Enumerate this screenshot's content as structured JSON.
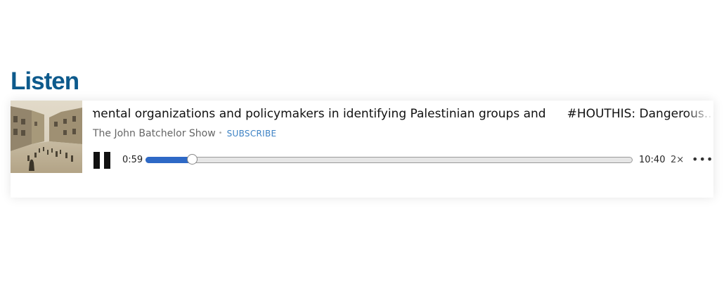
{
  "heading": "Listen",
  "player": {
    "episode_titles": [
      "ımental organizations and policymakers in identifying Palestinian groups and",
      "#HOUTHIS: Dangerous..."
    ],
    "show_name": "The John Batchelor Show",
    "separator": "•",
    "subscribe_label": "SUBSCRIBE",
    "elapsed": "0:59",
    "duration": "10:40",
    "progress_fraction": 0.095,
    "speed_label": "2×",
    "more_label": "•••",
    "artwork_icon": "street-scene-photo",
    "accent_color": "#2e69c6",
    "heading_color": "#0d5a8c",
    "subscribe_color": "#3d82c4"
  }
}
